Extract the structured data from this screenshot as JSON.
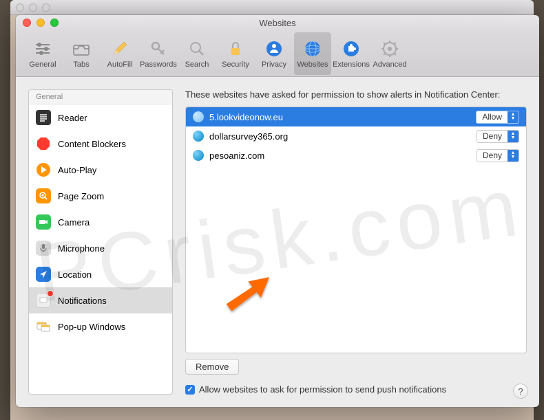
{
  "window": {
    "title": "Websites"
  },
  "toolbar": {
    "items": [
      {
        "label": "General"
      },
      {
        "label": "Tabs"
      },
      {
        "label": "AutoFill"
      },
      {
        "label": "Passwords"
      },
      {
        "label": "Search"
      },
      {
        "label": "Security"
      },
      {
        "label": "Privacy"
      },
      {
        "label": "Websites"
      },
      {
        "label": "Extensions"
      },
      {
        "label": "Advanced"
      }
    ]
  },
  "sidebar": {
    "header": "General",
    "items": [
      {
        "label": "Reader"
      },
      {
        "label": "Content Blockers"
      },
      {
        "label": "Auto-Play"
      },
      {
        "label": "Page Zoom"
      },
      {
        "label": "Camera"
      },
      {
        "label": "Microphone"
      },
      {
        "label": "Location"
      },
      {
        "label": "Notifications"
      },
      {
        "label": "Pop-up Windows"
      }
    ]
  },
  "main": {
    "heading": "These websites have asked for permission to show alerts in Notification Center:",
    "rows": [
      {
        "domain": "5.lookvideonow.eu",
        "permission": "Allow"
      },
      {
        "domain": "dollarsurvey365.org",
        "permission": "Deny"
      },
      {
        "domain": "pesoaniz.com",
        "permission": "Deny"
      }
    ],
    "remove_label": "Remove",
    "checkbox_label": "Allow websites to ask for permission to send push notifications"
  }
}
